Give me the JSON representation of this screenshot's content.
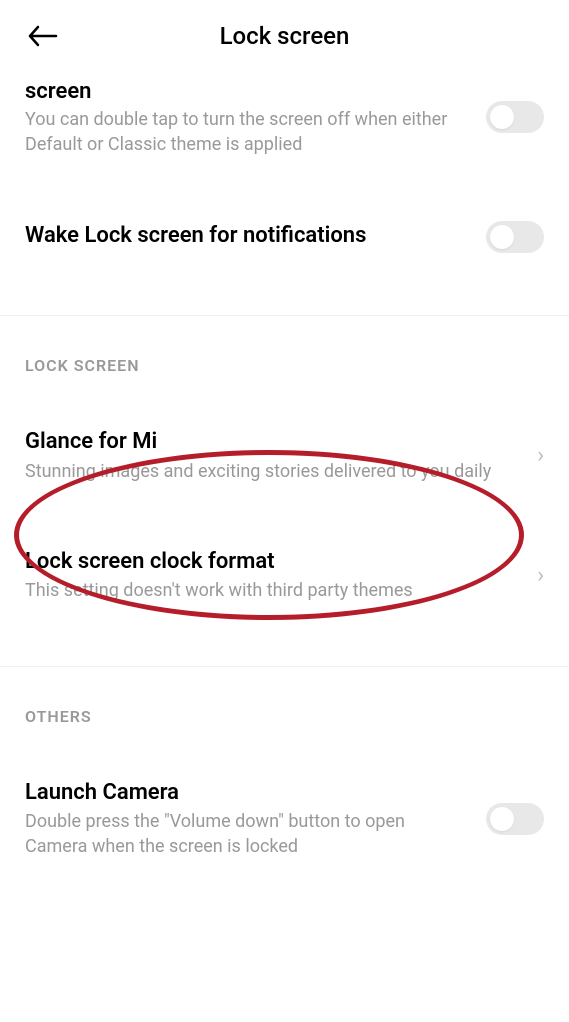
{
  "header": {
    "title": "Lock screen"
  },
  "items": {
    "doubleTap": {
      "partialTitle": "screen",
      "desc": "You can double tap to turn the screen off when either Default or Classic theme is applied"
    },
    "wakeLock": {
      "title": "Wake Lock screen for notifications"
    }
  },
  "sections": {
    "lockScreen": {
      "header": "LOCK SCREEN",
      "glance": {
        "title": "Glance for Mi",
        "desc": "Stunning images and exciting stories delivered to you daily"
      },
      "clockFormat": {
        "title": "Lock screen clock format",
        "desc": "This setting doesn't work with third party themes"
      }
    },
    "others": {
      "header": "OTHERS",
      "launchCamera": {
        "title": "Launch Camera",
        "desc": "Double press the \"Volume down\" button to open Camera when the screen is locked"
      }
    }
  }
}
